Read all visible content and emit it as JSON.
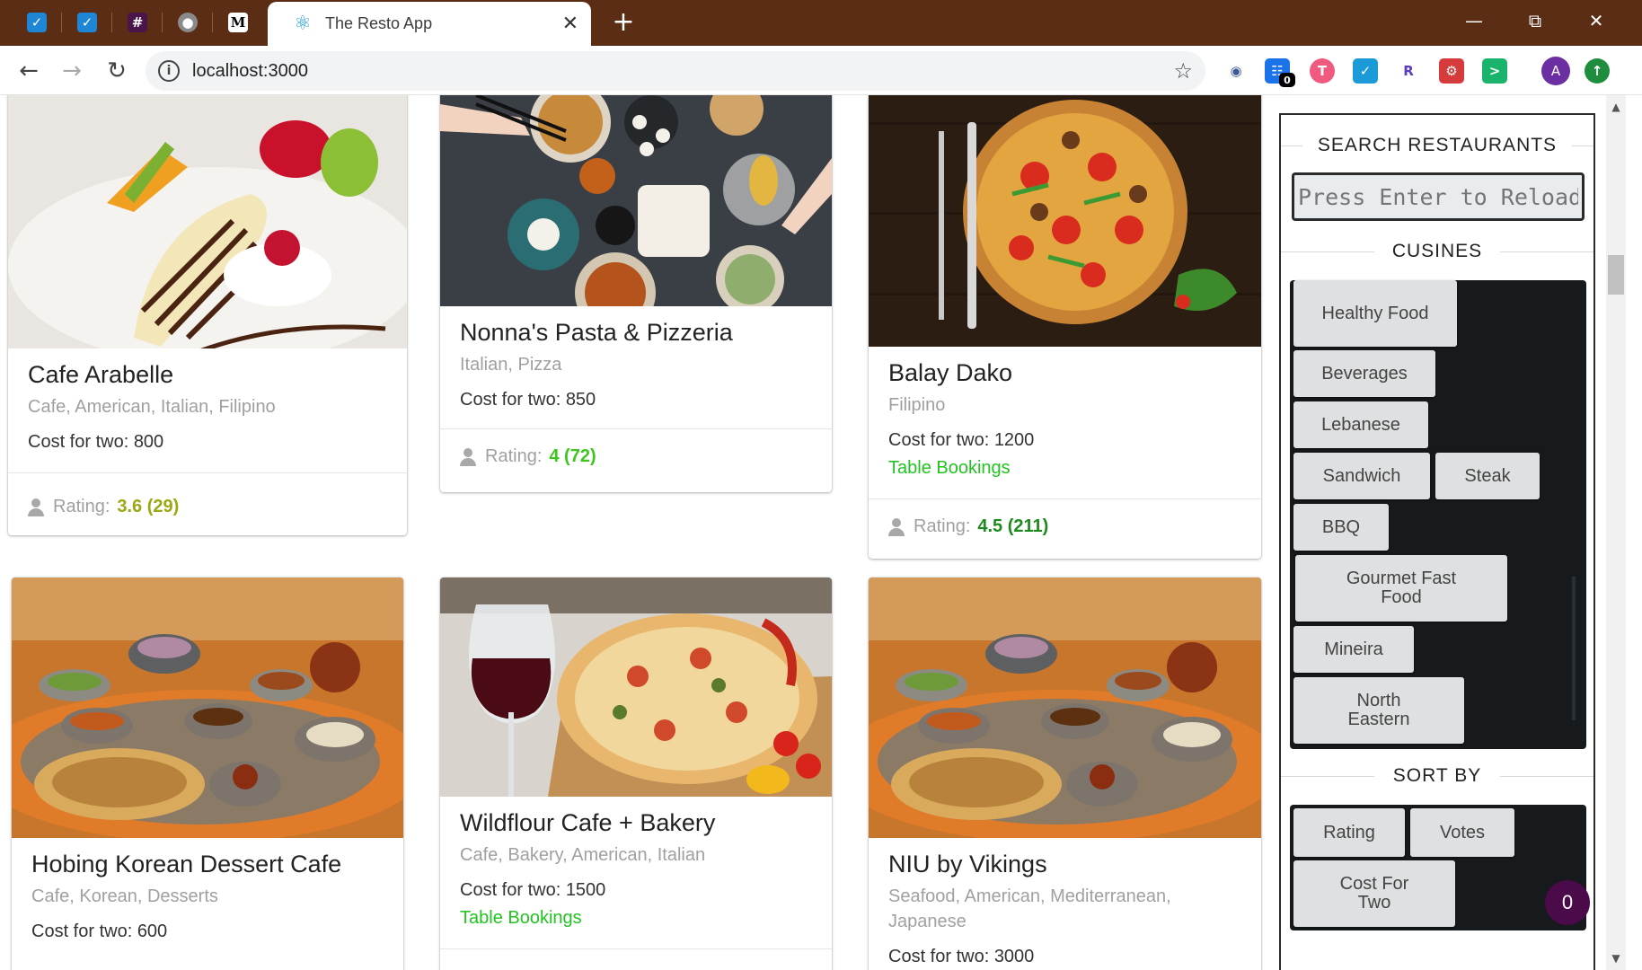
{
  "browser": {
    "tab_title": "The Resto App",
    "url": "localhost:3000",
    "extension_badge": "0",
    "profile_initial": "A"
  },
  "search": {
    "heading": "SEARCH RESTAURANTS",
    "placeholder": "Press Enter to Reload"
  },
  "cuisines": {
    "heading": "CUSINES",
    "items": [
      "Healthy Food",
      "Beverages",
      "Lebanese",
      "Sandwich",
      "Steak",
      "BBQ",
      "Gourmet Fast Food",
      "Mineira",
      "North Eastern"
    ]
  },
  "sort": {
    "heading": "SORT BY",
    "items": [
      "Rating",
      "Votes",
      "Cost For Two"
    ]
  },
  "cart": {
    "count": "0"
  },
  "rating_label": "Rating:",
  "restaurants": [
    {
      "name": "Cafe Arabelle",
      "cuisines": "Cafe, American, Italian, Filipino",
      "cost": "Cost for two: 800",
      "booking": "",
      "rating": "3.6 (29)",
      "rating_color": "#9aa812",
      "image": "dessert-banana"
    },
    {
      "name": "Nonna's Pasta & Pizzeria",
      "cuisines": "Italian, Pizza",
      "cost": "Cost for two: 850",
      "booking": "",
      "rating": "4 (72)",
      "rating_color": "#3cc61e",
      "image": "asian-spread"
    },
    {
      "name": "Balay Dako",
      "cuisines": "Filipino",
      "cost": "Cost for two: 1200",
      "booking": "Table Bookings",
      "rating": "4.5 (211)",
      "rating_color": "#1d8a1d",
      "image": "pizza-dark"
    },
    {
      "name": "Hobing Korean Dessert Cafe",
      "cuisines": "Cafe, Korean, Desserts",
      "cost": "Cost for two: 600",
      "booking": "",
      "rating": "",
      "rating_color": "",
      "image": "thali-platter"
    },
    {
      "name": "Wildflour Cafe + Bakery",
      "cuisines": "Cafe, Bakery, American, Italian",
      "cost": "Cost for two: 1500",
      "booking": "Table Bookings",
      "rating": "",
      "rating_color": "",
      "image": "wine-pizza"
    },
    {
      "name": "NIU by Vikings",
      "cuisines": "Seafood, American, Mediterranean, Japanese",
      "cost": "Cost for two: 3000",
      "booking": "",
      "rating": "",
      "rating_color": "",
      "image": "thali-platter"
    }
  ]
}
